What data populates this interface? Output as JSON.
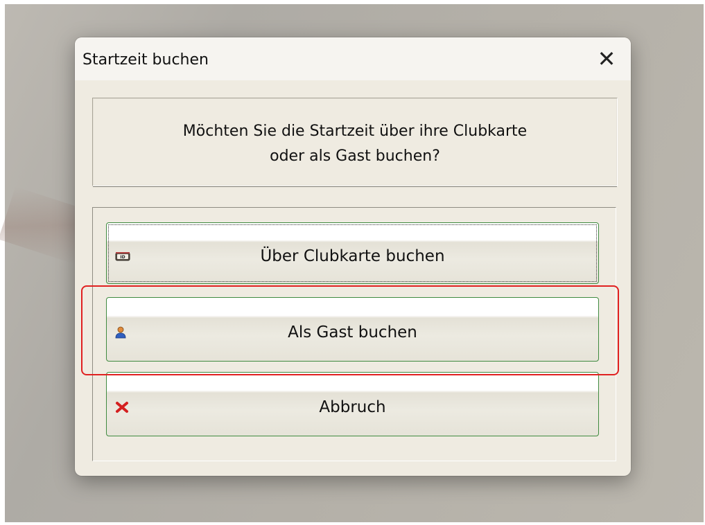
{
  "window": {
    "title": "Startzeit buchen",
    "close_label": "✕"
  },
  "message": {
    "line1": "Möchten Sie die Startzeit über ihre Clubkarte",
    "line2": "oder als Gast buchen?"
  },
  "buttons": [
    {
      "label": "Über Clubkarte buchen",
      "icon": "id-card-icon"
    },
    {
      "label": "Als Gast buchen",
      "icon": "guest-user-icon"
    },
    {
      "label": "Abbruch",
      "icon": "red-x-cancel-icon"
    }
  ],
  "colors": {
    "button_border": "#3f8a3f",
    "highlight": "#e02020",
    "dialog_bg": "#efebe1"
  }
}
